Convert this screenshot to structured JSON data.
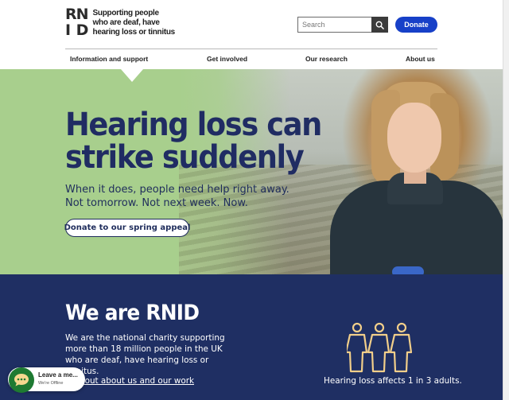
{
  "header": {
    "logo": {
      "mark": [
        "R",
        "N",
        "I",
        "D"
      ],
      "tagline_lines": [
        "Supporting people",
        "who are deaf, have",
        "hearing loss or tinnitus"
      ]
    },
    "search": {
      "placeholder": "Search",
      "icon": "search-icon"
    },
    "donate_label": "Donate",
    "nav": [
      "Information and support",
      "Get involved",
      "Our research",
      "About us"
    ]
  },
  "hero": {
    "title_lines": [
      "Hearing loss can",
      "strike suddenly"
    ],
    "body": "When it does, people need help right away. Not tomorrow. Not next week. Now.",
    "button_label": "Donate to our spring appeal",
    "background_color": "#a8cf8d"
  },
  "about": {
    "title": "We are RNID",
    "body": "We are the national charity supporting more than 18 million people in the UK who are deaf, have hearing loss or tinnitus.",
    "link_label": "Find out about us and our work",
    "stat_icon": "three-people-icon",
    "stat": "Hearing loss affects 1 in 3 adults.",
    "background_color": "#1f2f63"
  },
  "chat": {
    "title": "Leave a me...",
    "status": "We're Offline",
    "icon": "chat-bubble-icon"
  },
  "colors": {
    "navy": "#1f2d5c",
    "donate_blue": "#1740c8",
    "icon_gold": "#f2cf8a"
  }
}
